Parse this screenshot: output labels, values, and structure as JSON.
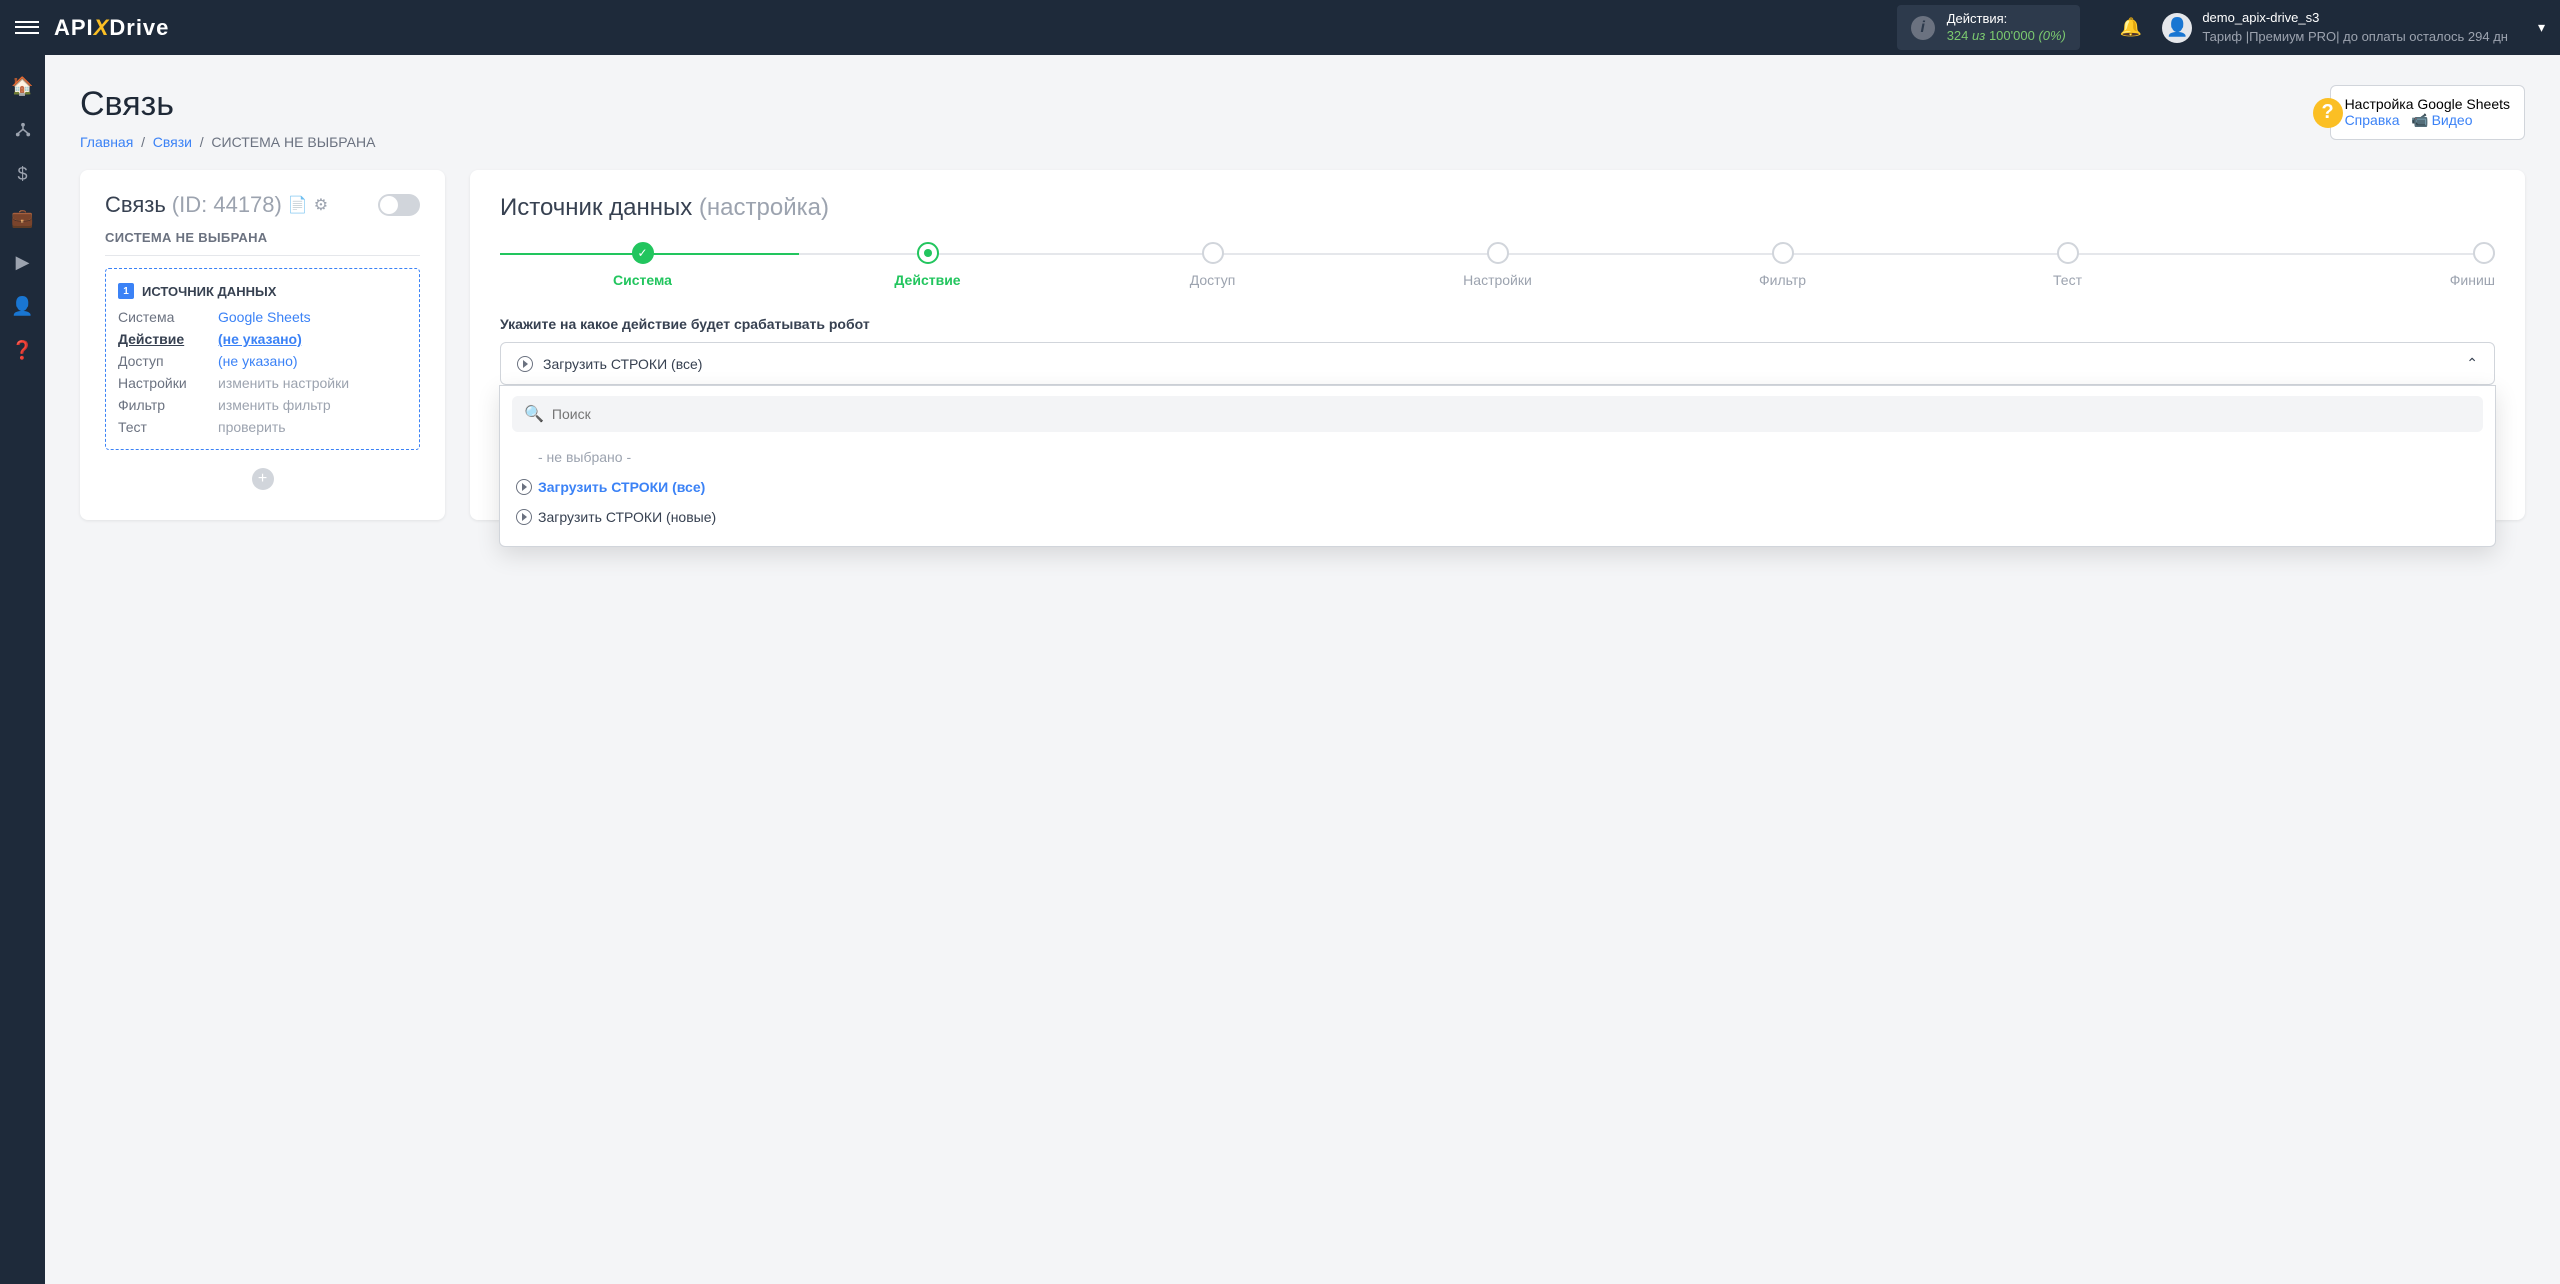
{
  "topbar": {
    "logo_pre": "API",
    "logo_x": "X",
    "logo_post": "Drive",
    "actions_label": "Действия:",
    "actions_used": "324",
    "actions_of": "из",
    "actions_total": "100'000",
    "actions_pct": "(0%)",
    "user_name": "demo_apix-drive_s3",
    "tariff_line": "Тариф |Премиум PRO| до оплаты осталось 294 дн"
  },
  "page": {
    "title": "Связь",
    "bc_home": "Главная",
    "bc_links": "Связи",
    "bc_current": "СИСТЕМА НЕ ВЫБРАНА"
  },
  "help": {
    "title": "Настройка Google Sheets",
    "ref": "Справка",
    "video": "Видео"
  },
  "left": {
    "title": "Связь",
    "id": "(ID: 44178)",
    "sys_label": "СИСТЕМА НЕ ВЫБРАНА",
    "src_title": "ИСТОЧНИК ДАННЫХ",
    "rows": {
      "k_system": "Система",
      "v_system": "Google Sheets",
      "k_action": "Действие",
      "v_action": "(не указано)",
      "k_access": "Доступ",
      "v_access": "(не указано)",
      "k_settings": "Настройки",
      "v_settings": "изменить настройки",
      "k_filter": "Фильтр",
      "v_filter": "изменить фильтр",
      "k_test": "Тест",
      "v_test": "проверить"
    }
  },
  "right": {
    "title": "Источник данных",
    "title_sub": "(настройка)",
    "steps": [
      "Система",
      "Действие",
      "Доступ",
      "Настройки",
      "Фильтр",
      "Тест",
      "Финиш"
    ],
    "instruction": "Укажите на какое действие будет срабатывать робот",
    "selected": "Загрузить СТРОКИ (все)",
    "search_placeholder": "Поиск",
    "opt_none": "- не выбрано -",
    "opt_all": "Загрузить СТРОКИ (все)",
    "opt_new": "Загрузить СТРОКИ (новые)"
  }
}
